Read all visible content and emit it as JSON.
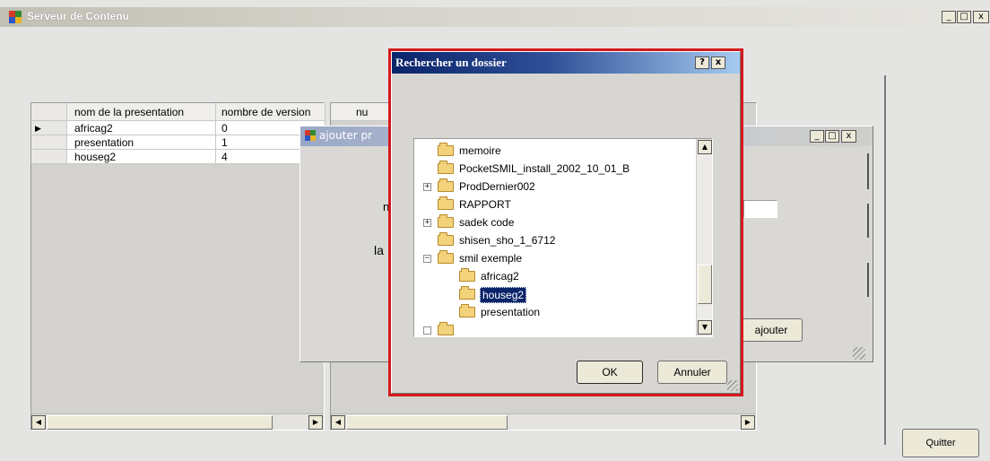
{
  "main_window": {
    "title": "Serveur de Contenu",
    "minimize": "_",
    "maximize": "□",
    "close": "x"
  },
  "presentations_grid": {
    "columns": [
      "nom de la presentation",
      "nombre de version"
    ],
    "rows": [
      {
        "name": "africag2",
        "versions": "0"
      },
      {
        "name": "presentation",
        "versions": "1"
      },
      {
        "name": "houseg2",
        "versions": "4"
      }
    ],
    "current_row_marker": "▶"
  },
  "versions_grid": {
    "column_partial": "nu"
  },
  "add_dialog": {
    "title": "ajouter pr",
    "label_n": "n",
    "label_la": "la",
    "add_button": "ajouter"
  },
  "folder_dialog": {
    "title": "Rechercher un dossier",
    "help": "?",
    "close": "x",
    "items": [
      {
        "label": "memoire",
        "expander": ""
      },
      {
        "label": "PocketSMIL_install_2002_10_01_B",
        "expander": ""
      },
      {
        "label": "ProdDernier002",
        "expander": "+"
      },
      {
        "label": "RAPPORT",
        "expander": ""
      },
      {
        "label": "sadek code",
        "expander": "+"
      },
      {
        "label": "shisen_sho_1_6712",
        "expander": ""
      },
      {
        "label": "smil exemple",
        "expander": "−"
      },
      {
        "label": "africag2",
        "expander": ""
      },
      {
        "label": "houseg2",
        "expander": "",
        "selected": true
      },
      {
        "label": "presentation",
        "expander": ""
      }
    ],
    "ok": "OK",
    "cancel": "Annuler"
  },
  "quit_button": "Quitter",
  "colors": {
    "title_bar_start": "#c9c6bb",
    "dialog_title_start": "#0a246a",
    "dialog_title_end": "#a6caf0",
    "highlight_border": "#d4181c",
    "selection": "#0a246a"
  }
}
